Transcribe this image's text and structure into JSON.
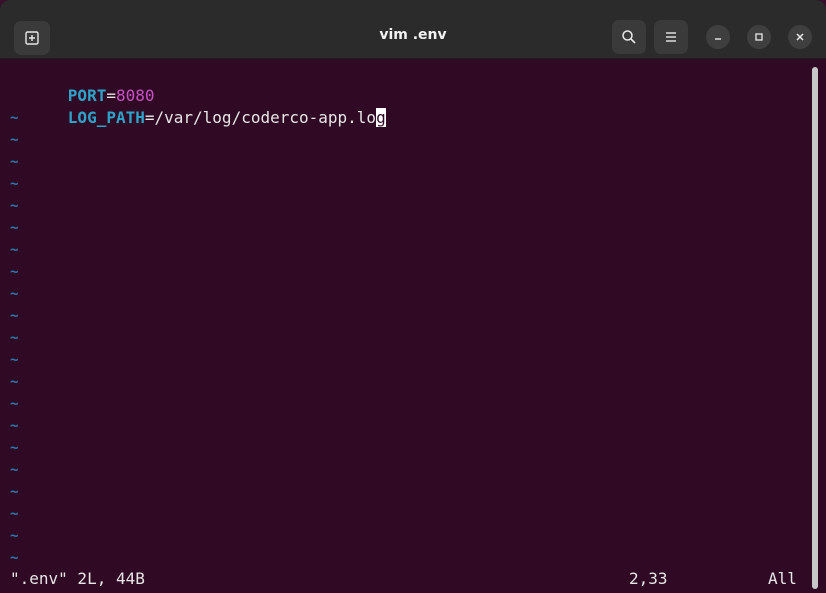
{
  "window": {
    "title": "vim .env",
    "icons": {
      "new_tab": "new-tab-icon",
      "search": "search-icon",
      "menu": "hamburger-menu-icon",
      "minimize": "minimize-icon",
      "maximize": "maximize-icon",
      "close": "close-icon"
    }
  },
  "editor": {
    "lines": [
      {
        "key": "PORT",
        "sep": "=",
        "value": "8080",
        "value_type": "number"
      },
      {
        "key": "LOG_PATH",
        "sep": "=",
        "value": "/var/log/coderco-app.lo",
        "cursor_char": "g",
        "value_type": "string"
      }
    ],
    "tilde_char": "~",
    "tilde_count": 21,
    "status_message": "\".env\" 2L, 44B",
    "cursor_position": "2,33",
    "scroll_position": "All"
  },
  "colors": {
    "background": "#300a24",
    "key": "#2ea3c9",
    "number": "#c752c7",
    "tilde": "#2a7bb0",
    "titlebar": "#2b2b2b"
  }
}
